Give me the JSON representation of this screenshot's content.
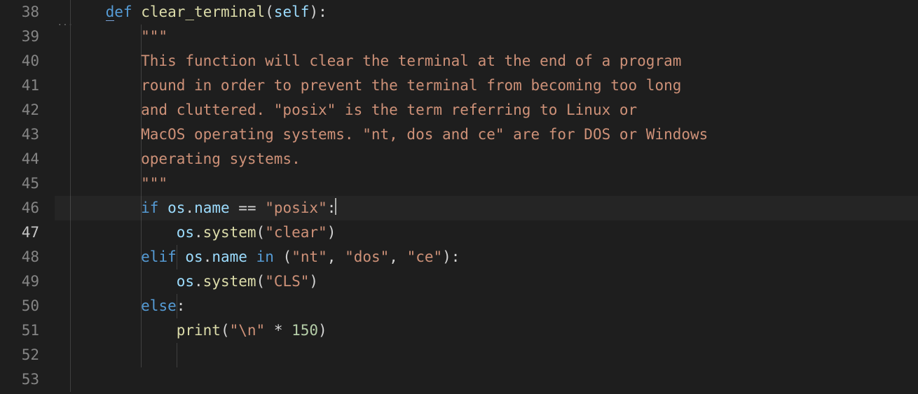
{
  "gutter": {
    "start": 38,
    "end": 53,
    "active": 47
  },
  "code": {
    "l38": {
      "indent": "        ",
      "kw": "def",
      "fn": "clear_terminal",
      "open": "(",
      "self": "self",
      "close": "):"
    },
    "l39_tok": "        \"\"\"",
    "l40_doc": "        This function will clear the terminal at the end of a program",
    "l41_doc": "        round in order to prevent the terminal from becoming too long",
    "l42_doc": "        and cluttered. \"posix\" is the term referring to Linux or",
    "l43_doc": "        MacOS operating systems. \"nt, dos and ce\" are for DOS or Windows",
    "l44_doc": "        operating systems.",
    "l45_tok": "        \"\"\"",
    "l47_if": "if",
    "l47_os": "os",
    "l47_name": "name",
    "l47_eq": " == ",
    "l47_str": "\"posix\"",
    "l48_os": "os",
    "l48_sys": "system",
    "l48_arg": "\"clear\"",
    "l49_elif": "elif",
    "l49_os": "os",
    "l49_name": "name",
    "l49_in": "in",
    "l49_s1": "\"nt\"",
    "l49_s2": "\"dos\"",
    "l49_s3": "\"ce\"",
    "l50_os": "os",
    "l50_sys": "system",
    "l50_arg": "\"CLS\"",
    "l51_else": "else",
    "l52_print": "print",
    "l52_str": "\"\\n\"",
    "l52_num": "150"
  },
  "dots_glyph": "···"
}
